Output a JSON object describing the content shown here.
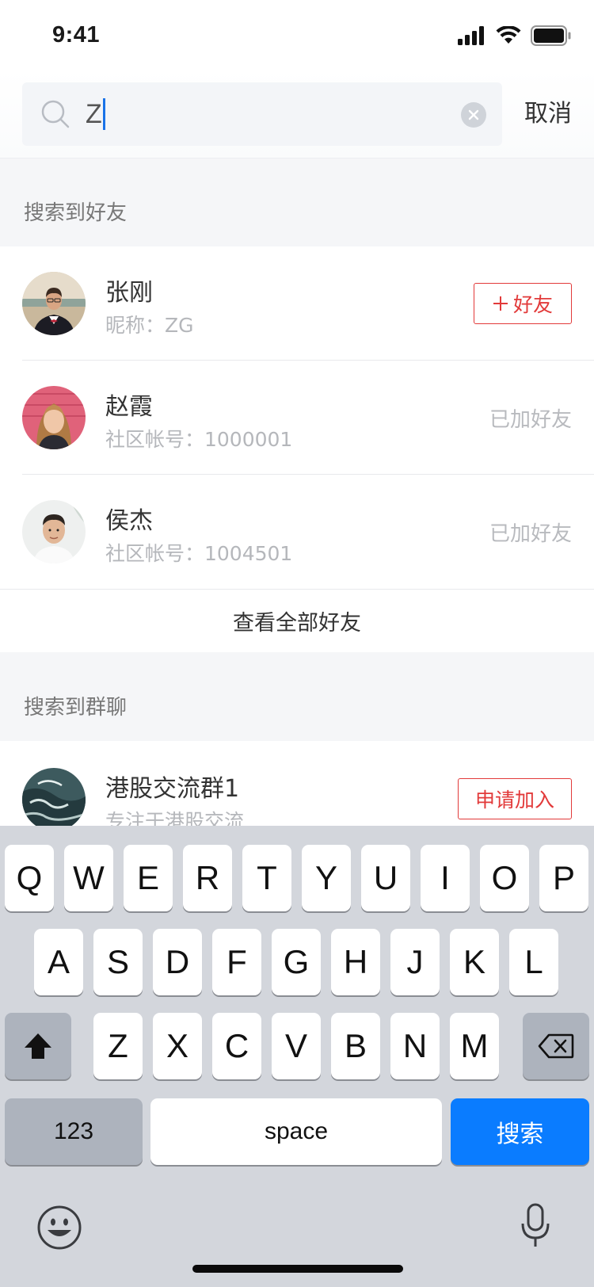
{
  "status_bar": {
    "time": "9:41",
    "icons": [
      "signal-icon",
      "wifi-icon",
      "battery-icon"
    ]
  },
  "search": {
    "query": "Z",
    "cancel_label": "取消"
  },
  "friends_section": {
    "header": "搜索到好友",
    "results": [
      {
        "name": "张刚",
        "sub": "昵称：ZG",
        "action": "add",
        "action_label": "好友"
      },
      {
        "name": "赵霞",
        "sub": "社区帐号：1000001",
        "action": "added",
        "action_label": "已加好友"
      },
      {
        "name": "侯杰",
        "sub": "社区帐号：1004501",
        "action": "added",
        "action_label": "已加好友"
      }
    ],
    "view_all_label": "查看全部好友"
  },
  "groups_section": {
    "header": "搜索到群聊",
    "results": [
      {
        "name": "港股交流群1",
        "sub": "专注于港股交流",
        "action_label": "申请加入"
      }
    ]
  },
  "keyboard": {
    "row1": [
      "Q",
      "W",
      "E",
      "R",
      "T",
      "Y",
      "U",
      "I",
      "O",
      "P"
    ],
    "row2": [
      "A",
      "S",
      "D",
      "F",
      "G",
      "H",
      "J",
      "K",
      "L"
    ],
    "row3": [
      "Z",
      "X",
      "C",
      "V",
      "B",
      "N",
      "M"
    ],
    "numbers_label": "123",
    "space_label": "space",
    "search_label": "搜索"
  },
  "colors": {
    "accent_red": "#e23a3a",
    "keyboard_blue": "#0a7cff",
    "caret_blue": "#1a73e8"
  }
}
